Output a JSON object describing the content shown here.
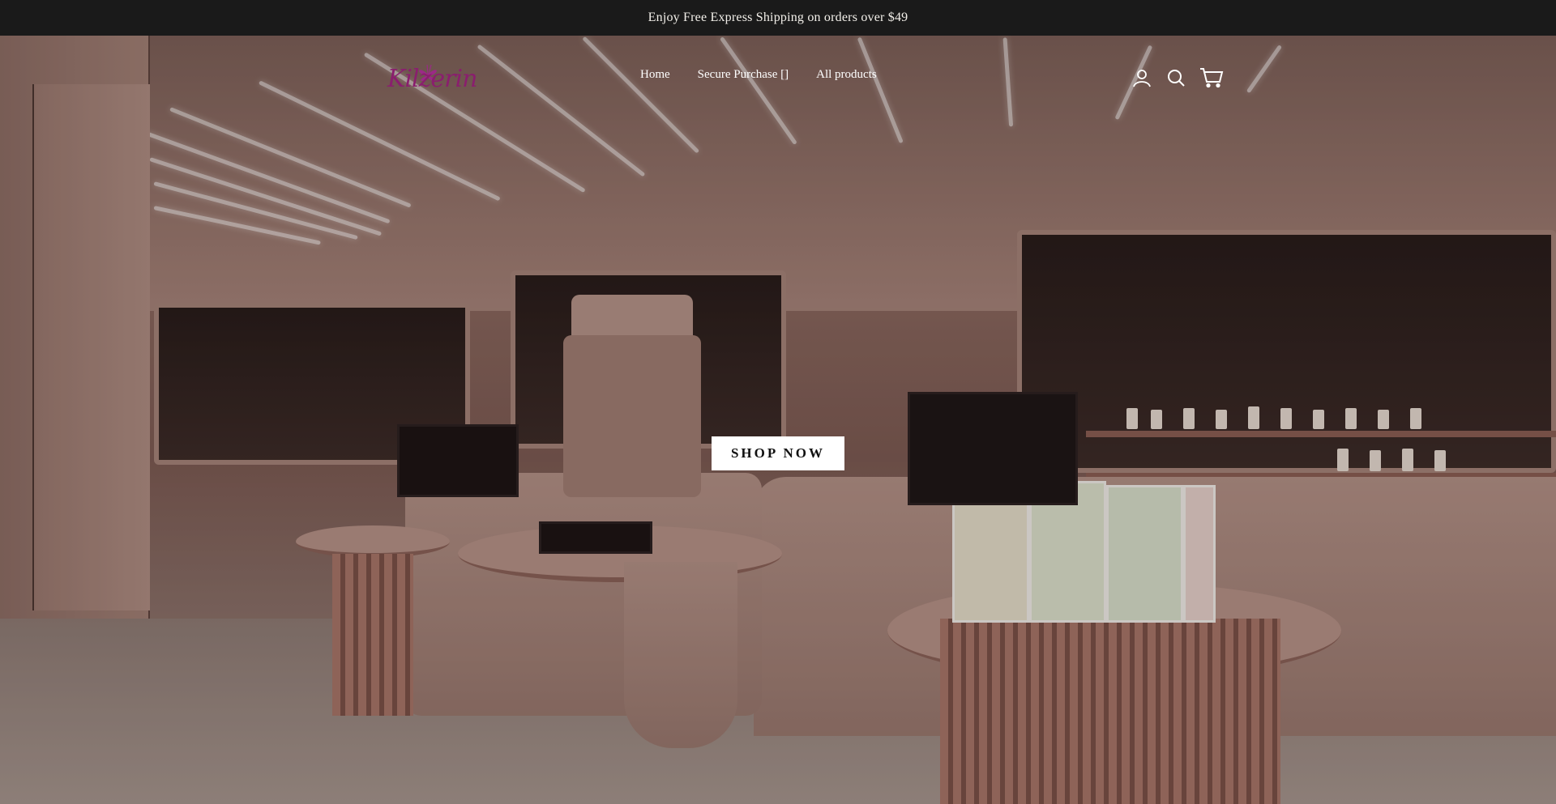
{
  "announcement": {
    "text": "Enjoy Free Express Shipping on orders over $49"
  },
  "header": {
    "logo_text": "Kilzerin",
    "nav": [
      {
        "label": "Home"
      },
      {
        "label": "Secure Purchase []"
      },
      {
        "label": "All products"
      }
    ],
    "icons": [
      "account-icon",
      "search-icon",
      "cart-icon"
    ]
  },
  "hero": {
    "cta_label": "SHOP NOW",
    "background_description_colors": {
      "accent": "#8a1e6e",
      "bar": "#1a1a1a"
    }
  }
}
